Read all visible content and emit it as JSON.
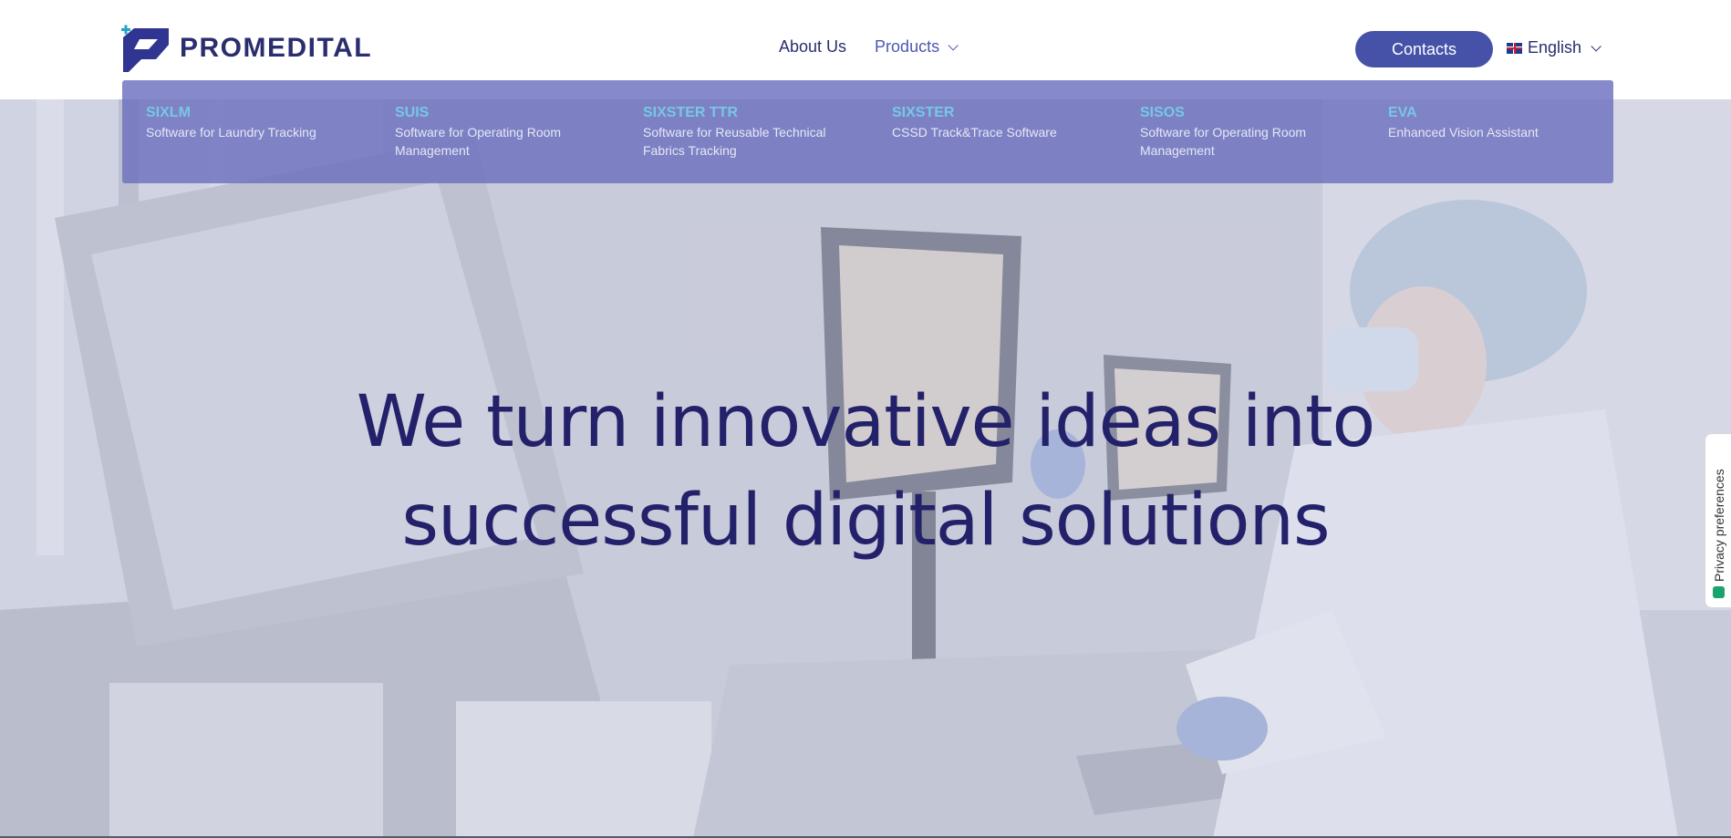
{
  "header": {
    "logo_text": "PROMEDITAL",
    "nav": {
      "about_label": "About Us",
      "products_label": "Products"
    },
    "contacts_label": "Contacts",
    "language_label": "English"
  },
  "products_menu": {
    "items": [
      {
        "name": "SIXLM",
        "description": "Software for Laundry Tracking"
      },
      {
        "name": "SUIS",
        "description": "Software for Operating Room Management"
      },
      {
        "name": "SIXSTER TTR",
        "description": "Software for Reusable Technical Fabrics Tracking"
      },
      {
        "name": "SIXSTER",
        "description": "CSSD Track&Trace Software"
      },
      {
        "name": "SISOS",
        "description": "Software for Operating Room Management"
      },
      {
        "name": "EVA",
        "description": "Enhanced Vision Assistant"
      }
    ]
  },
  "hero": {
    "title_line1": "We turn innovative ideas into",
    "title_line2": "successful digital solutions"
  },
  "privacy_tab": {
    "label": "Privacy preferences"
  },
  "colors": {
    "brand_dark": "#2a2d6e",
    "brand_accent": "#4552a8",
    "menu_name": "#77c7e5",
    "logo_plus": "#1da7c9"
  }
}
